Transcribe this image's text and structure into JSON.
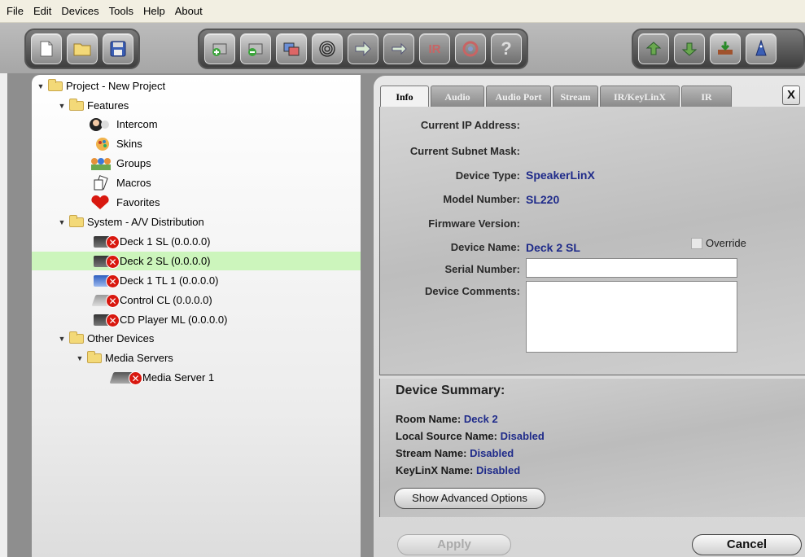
{
  "menu": [
    "File",
    "Edit",
    "Devices",
    "Tools",
    "Help",
    "About"
  ],
  "toolbar": {
    "group1": [
      "new-project-icon",
      "open-project-icon",
      "save-icon"
    ],
    "group2": [
      "add-device-icon",
      "remove-device-icon",
      "copy-device-icon",
      "fingerprint-icon",
      "forward-arrow-icon",
      "sync-arrows-icon",
      "IR",
      "refresh-icon",
      "?"
    ],
    "group3": [
      "import-icon",
      "export-icon",
      "download-firmware-icon",
      "wizard-icon"
    ]
  },
  "tree": {
    "project": "Project - New Project",
    "features": "Features",
    "feature_items": [
      "Intercom",
      "Skins",
      "Groups",
      "Macros",
      "Favorites"
    ],
    "system": "System - A/V Distribution",
    "system_items": [
      "Deck 1 SL (0.0.0.0)",
      "Deck 2 SL (0.0.0.0)",
      "Deck 1 TL 1 (0.0.0.0)",
      "Control CL (0.0.0.0)",
      "CD Player ML (0.0.0.0)"
    ],
    "other": "Other Devices",
    "media_servers": "Media Servers",
    "media_server_item": "Media Server 1"
  },
  "tabs": [
    "Info",
    "Audio",
    "Audio Port",
    "Stream",
    "IR/KeyLinX",
    "IR"
  ],
  "close_label": "X",
  "info": {
    "current_ip_label": "Current IP Address:",
    "subnet_label": "Current Subnet Mask:",
    "device_type_label": "Device Type:",
    "device_type_value": "SpeakerLinX",
    "model_number_label": "Model Number:",
    "model_number_value": "SL220",
    "firmware_label": "Firmware Version:",
    "device_name_label": "Device Name:",
    "device_name_value": "Deck 2 SL",
    "override_label": "Override",
    "serial_label": "Serial Number:",
    "comments_label": "Device Comments:"
  },
  "summary": {
    "title": "Device Summary:",
    "room_label": "Room Name:",
    "room_value": "Deck 2",
    "local_source_label": "Local Source Name:",
    "local_source_value": "Disabled",
    "stream_label": "Stream Name:",
    "stream_value": "Disabled",
    "keylinx_label": "KeyLinX Name:",
    "keylinx_value": "Disabled",
    "advanced_button": "Show Advanced Options"
  },
  "buttons": {
    "apply": "Apply",
    "cancel": "Cancel"
  }
}
